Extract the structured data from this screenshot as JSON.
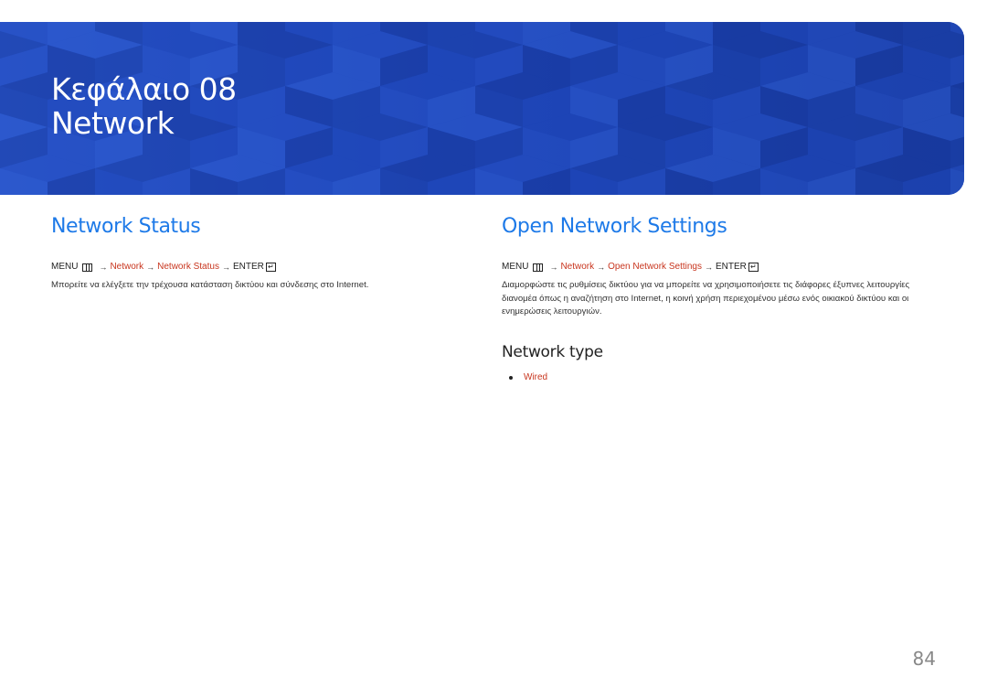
{
  "header": {
    "chapter_label": "Κεφάλαιο 08",
    "chapter_name": "Network",
    "background_color": "#1a3fb0"
  },
  "left": {
    "title": "Network Status",
    "path": {
      "menu": "MENU",
      "steps": [
        "Network",
        "Network Status"
      ],
      "enter": "ENTER"
    },
    "description": "Μπορείτε να ελέγξετε την τρέχουσα κατάσταση δικτύου και σύνδεσης στο Internet."
  },
  "right": {
    "title": "Open Network Settings",
    "path": {
      "menu": "MENU",
      "steps": [
        "Network",
        "Open Network Settings"
      ],
      "enter": "ENTER"
    },
    "description": "Διαμορφώστε τις ρυθμίσεις δικτύου για να μπορείτε να χρησιμοποιήσετε τις διάφορες έξυπνες λειτουργίες διανομέα όπως η αναζήτηση στο Internet, η κοινή χρήση περιεχομένου μέσω ενός οικιακού δικτύου και οι ενημερώσεις λειτουργιών.",
    "subsection": {
      "title": "Network type",
      "items": [
        "Wired"
      ]
    }
  },
  "page_number": "84",
  "colors": {
    "accent_blue": "#1e7ae8",
    "link_red": "#c8351e"
  }
}
